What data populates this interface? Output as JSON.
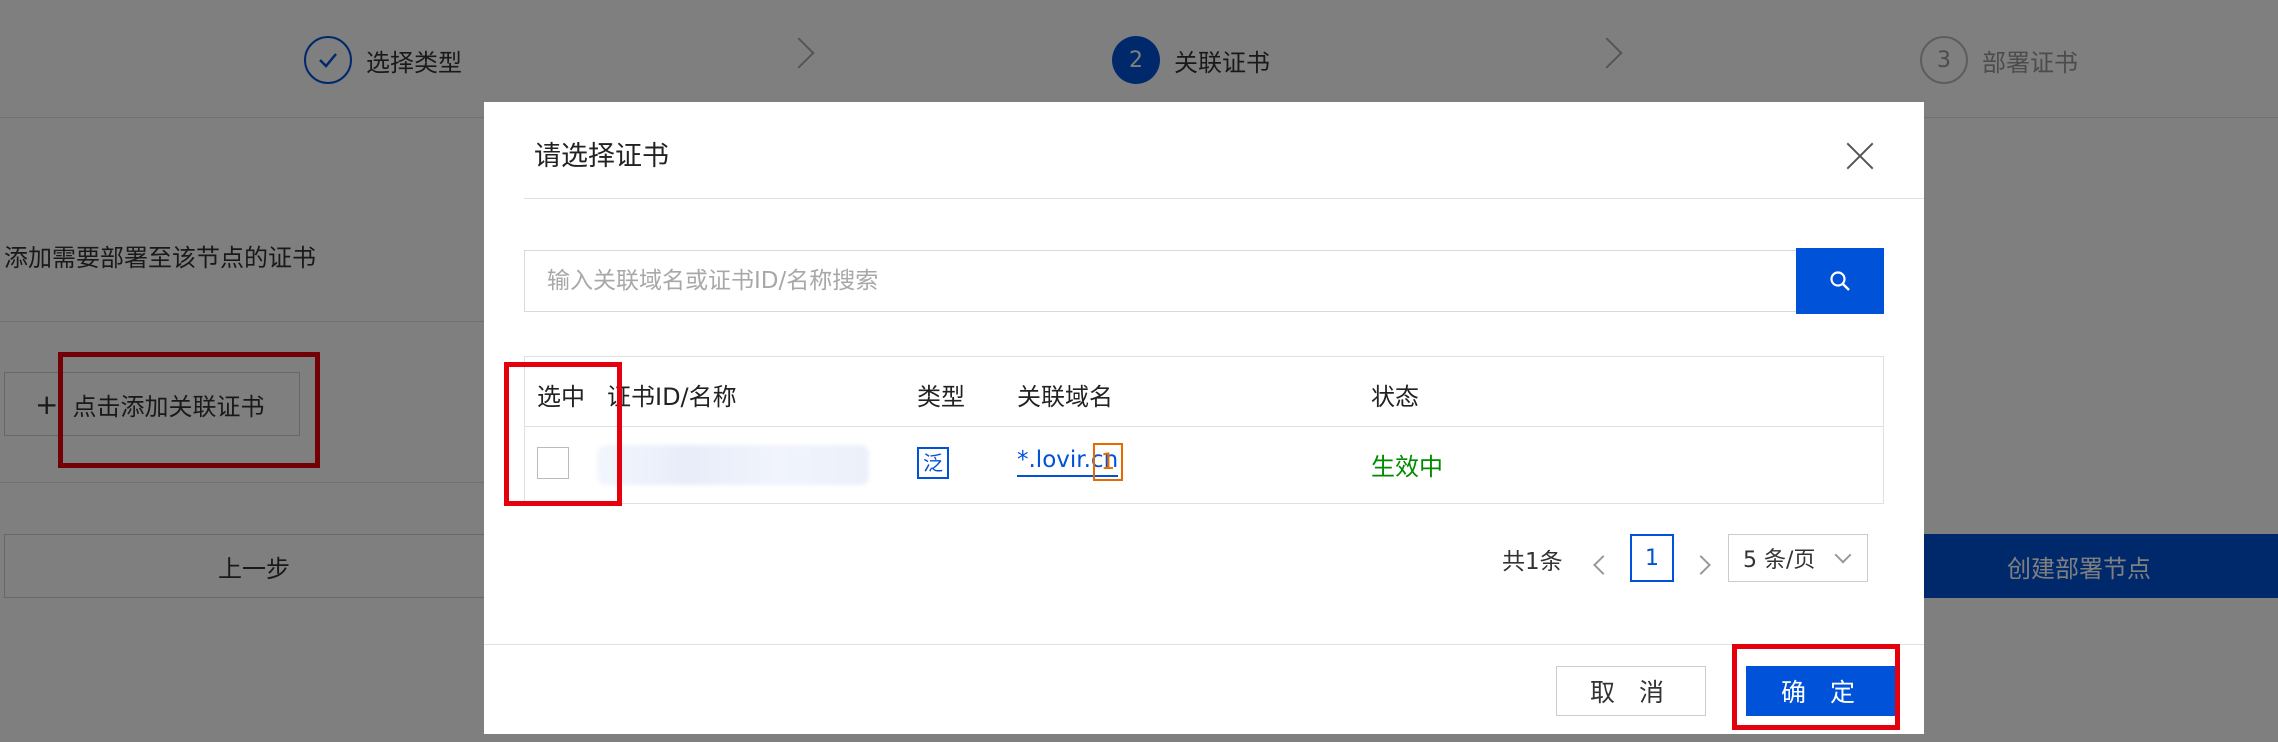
{
  "steps": [
    {
      "number": "",
      "label": "选择类型",
      "state": "done"
    },
    {
      "number": "2",
      "label": "关联证书",
      "state": "active"
    },
    {
      "number": "3",
      "label": "部署证书",
      "state": "todo"
    }
  ],
  "page": {
    "section_label": "添加需要部署至该节点的证书",
    "add_cert_label": "点击添加关联证书",
    "add_cert_icon": "plus-icon",
    "prev_label": "上一步",
    "create_label": "创建部署节点"
  },
  "modal": {
    "title": "请选择证书",
    "close_icon": "close-icon",
    "search": {
      "placeholder": "输入关联域名或证书ID/名称搜索",
      "value": "",
      "icon": "search-icon"
    },
    "table": {
      "headers": [
        "选中",
        "证书ID/名称",
        "类型",
        "关联域名",
        "状态"
      ],
      "rows": [
        {
          "checked": false,
          "id_name": "",
          "type_badge": "泛",
          "domain": "*.lovir.cn",
          "domain_count": "1",
          "status": "生效中"
        }
      ]
    },
    "pagination": {
      "total": "共1条",
      "current_page": "1",
      "page_size": "5 条/页"
    },
    "cancel_label": "取 消",
    "confirm_label": "确 定"
  },
  "colors": {
    "primary": "#0052d9",
    "highlight": "#e4000c",
    "status_active": "#008a00",
    "count_badge": "#e56b00",
    "overlay": "rgba(0,0,0,0.5)"
  }
}
